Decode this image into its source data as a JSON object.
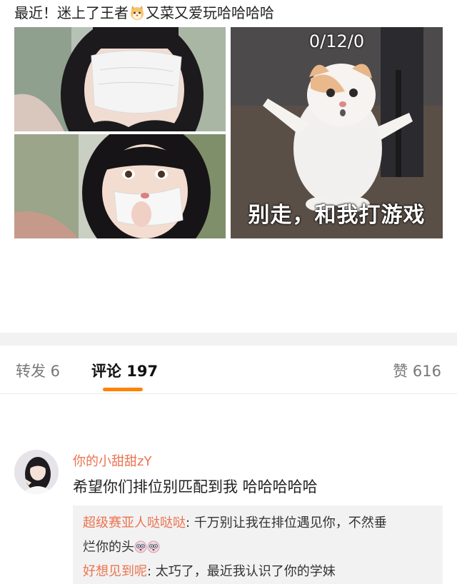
{
  "post": {
    "text_before": "最近！迷上了王者",
    "text_after": "又菜又爱玩哈哈哈哈",
    "meme_score": "0/12/0",
    "meme_caption": "别走，和我打游戏"
  },
  "tabs": {
    "repost": "转发 6",
    "comment": "评论 197",
    "like": "赞 616"
  },
  "comment": {
    "username": "你的小甜甜zY",
    "text": "希望你们排位别匹配到我 哈哈哈哈哈",
    "replies": [
      {
        "user": "超级赛亚人哒哒哒",
        "sep": ": ",
        "line1": "千万别让我在排位遇见你，不然垂",
        "line2": "烂你的头"
      },
      {
        "user": "好想见到呢",
        "sep": ": ",
        "text": "太巧了，最近我认识了你的学妹"
      }
    ]
  },
  "colors": {
    "accent": "#ff8200",
    "username": "#eb7350",
    "band": "#f2f2f2"
  },
  "icons": [
    "cat-emoji-icon",
    "surprised-face-emoji-icon"
  ]
}
